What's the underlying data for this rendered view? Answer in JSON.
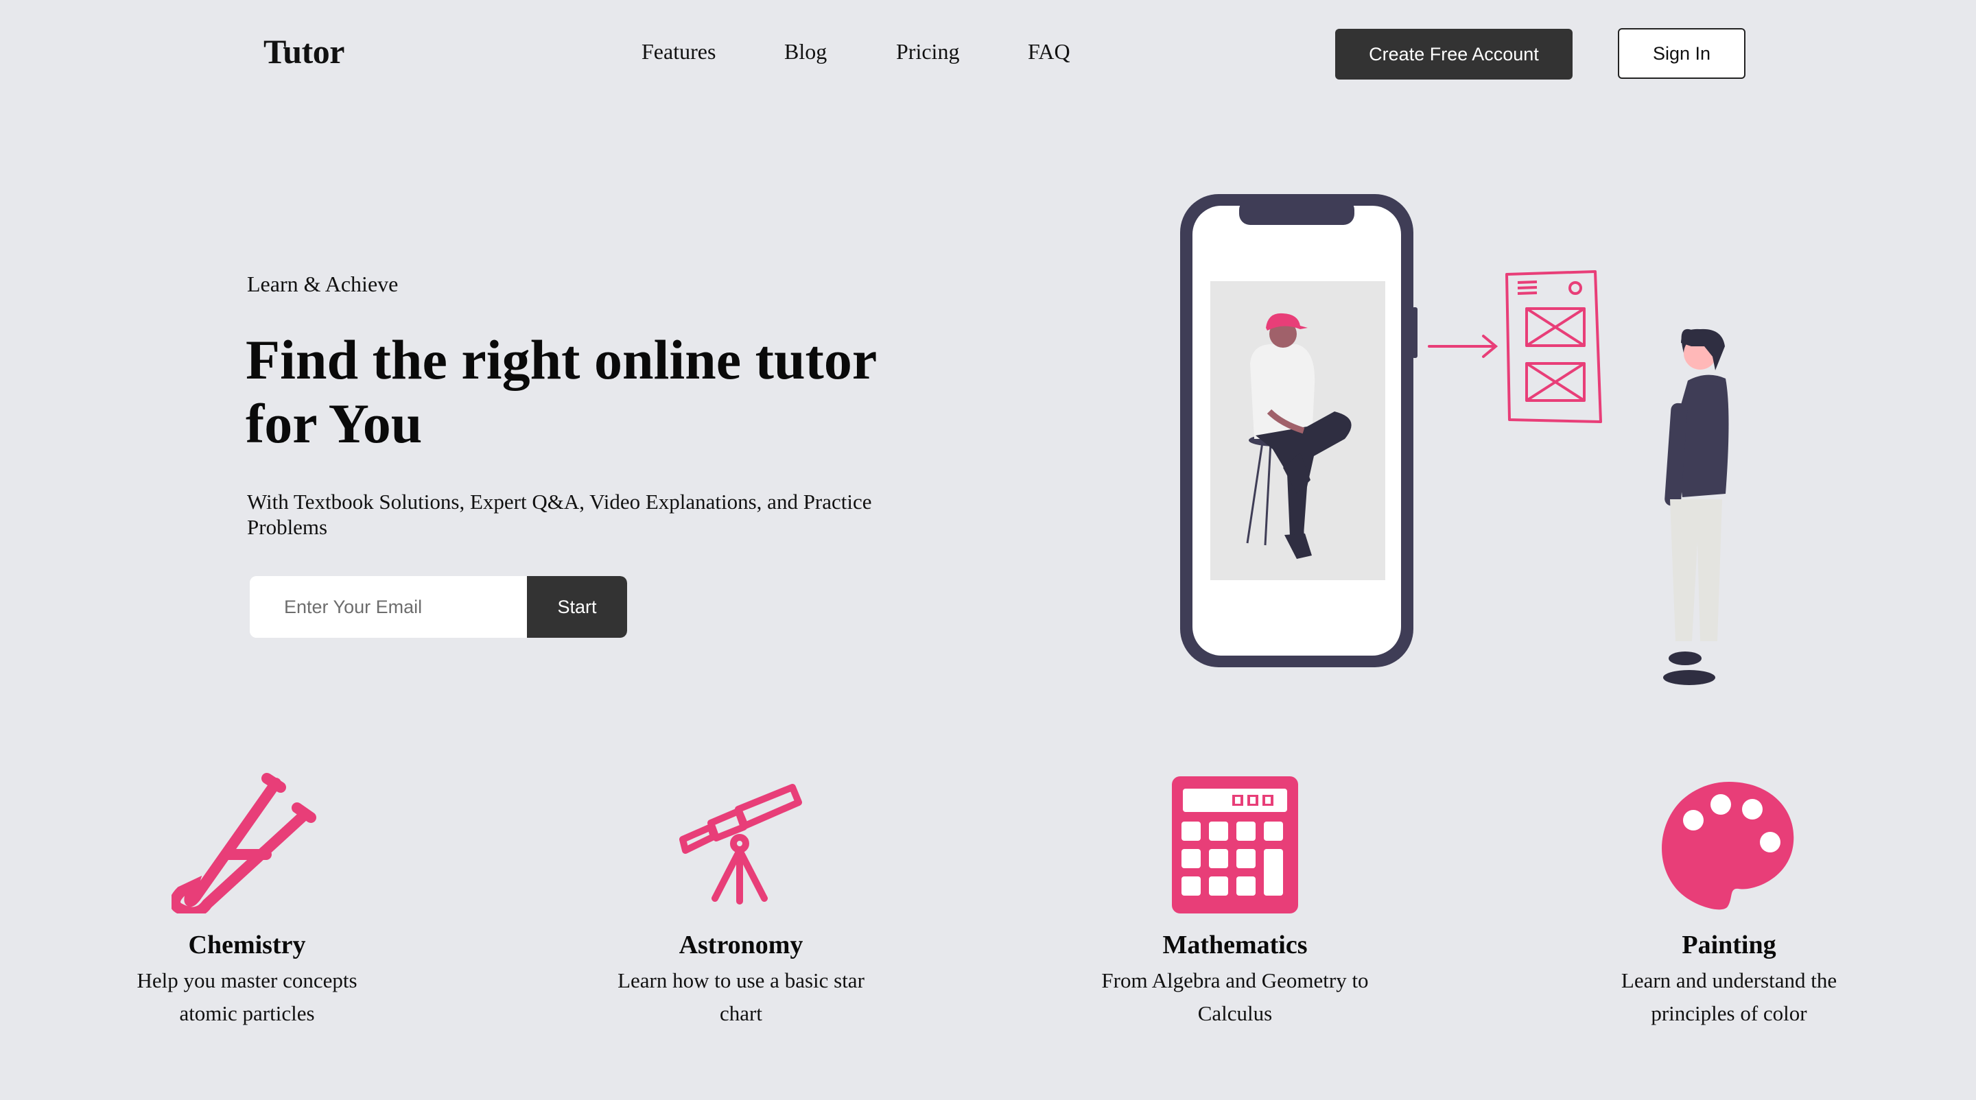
{
  "nav": {
    "logo": "Tutor",
    "links": [
      "Features",
      "Blog",
      "Pricing",
      "FAQ"
    ],
    "create_account": "Create Free Account",
    "sign_in": "Sign In"
  },
  "hero": {
    "eyebrow": "Learn & Achieve",
    "title": "Find the right online tutor for You",
    "subtitle": "With Textbook Solutions, Expert Q&A, Video Explanations, and Practice Problems",
    "email_placeholder": "Enter Your Email",
    "start_label": "Start"
  },
  "subjects": [
    {
      "icon": "test-tube-icon",
      "title": "Chemistry",
      "desc": "Help you master concepts atomic particles"
    },
    {
      "icon": "telescope-icon",
      "title": "Astronomy",
      "desc": "Learn how to use a basic star chart"
    },
    {
      "icon": "calculator-icon",
      "title": "Mathematics",
      "desc": "From Algebra and Geometry to Calculus"
    },
    {
      "icon": "palette-icon",
      "title": "Painting",
      "desc": "Learn and understand the principles of color"
    }
  ],
  "colors": {
    "background": "#e7e8ec",
    "accent": "#e83e78",
    "dark": "#333333",
    "phone_frame": "#3f3d56"
  }
}
